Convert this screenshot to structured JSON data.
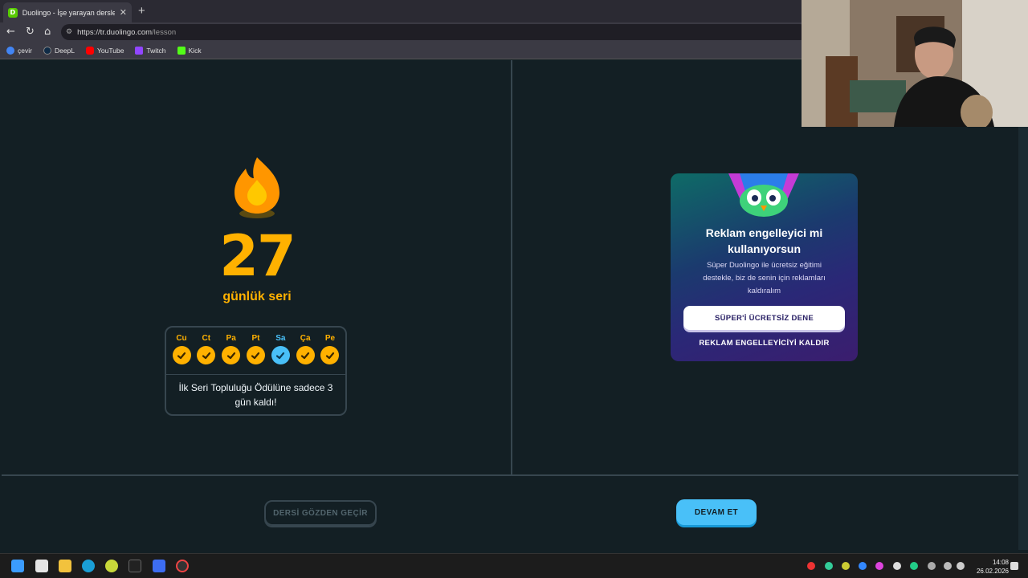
{
  "browser": {
    "tab_title": "Duolingo - İşe yarayan derslerle İn",
    "url_main": "https://tr.duolingo.com",
    "url_path": "/lesson",
    "bookmarks": [
      {
        "label": "çevir",
        "color": "#4285f4"
      },
      {
        "label": "DeepL",
        "color": "#0f2b46"
      },
      {
        "label": "YouTube",
        "color": "#ff0000"
      },
      {
        "label": "Twitch",
        "color": "#9146ff"
      },
      {
        "label": "Kick",
        "color": "#53fc18"
      }
    ]
  },
  "streak": {
    "count": "27",
    "label": "günlük seri",
    "days": [
      {
        "label": "Cu",
        "done": true,
        "today": false
      },
      {
        "label": "Ct",
        "done": true,
        "today": false
      },
      {
        "label": "Pa",
        "done": true,
        "today": false
      },
      {
        "label": "Pt",
        "done": true,
        "today": false
      },
      {
        "label": "Sa",
        "done": true,
        "today": true
      },
      {
        "label": "Ça",
        "done": true,
        "today": false
      },
      {
        "label": "Pe",
        "done": true,
        "today": false
      }
    ],
    "message_line1": "İlk Seri Topluluğu Ödülüne sadece 3",
    "message_line2": "gün kaldı!"
  },
  "ad": {
    "title_line1": "Reklam engelleyici mi",
    "title_line2": "kullanıyorsun",
    "desc_line1": "Süper Duolingo ile ücretsiz eğitimi",
    "desc_line2": "destekle, biz de senin için reklamları",
    "desc_line3": "kaldıralım",
    "try_button": "SÜPER'İ ÜCRETSİZ DENE",
    "remove_link": "REKLAM ENGELLEYİCİYİ KALDIR"
  },
  "footer": {
    "review_button": "DERSİ GÖZDEN GEÇİR",
    "continue_button": "DEVAM ET"
  },
  "taskbar": {
    "time": "14:08",
    "date": "26.02.2026"
  },
  "colors": {
    "background": "#131f24",
    "streak_orange": "#ffb100",
    "today_blue": "#49c0f8",
    "border": "#37464f"
  }
}
